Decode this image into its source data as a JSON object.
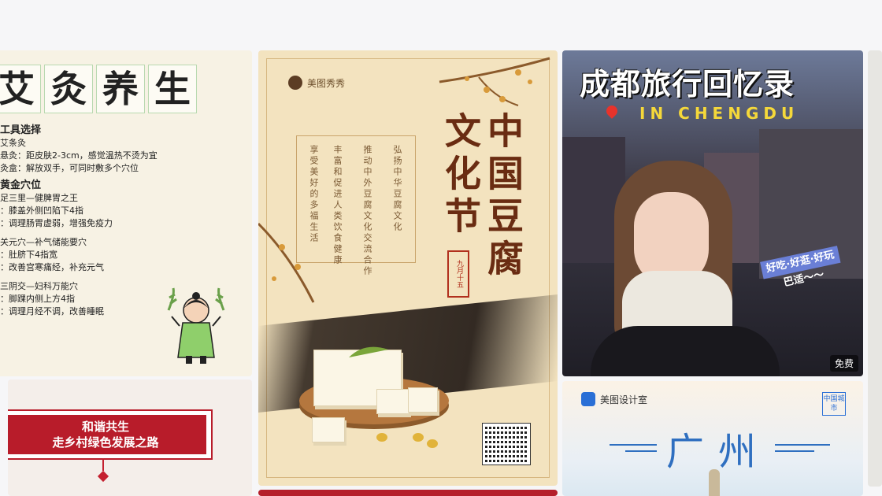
{
  "cards": [
    {
      "title_chars": [
        "艾",
        "灸",
        "养",
        "生"
      ],
      "lines": [
        {
          "text": "工具选择",
          "heading": true
        },
        {
          "text": "艾条灸",
          "heading": false
        },
        {
          "text": "悬灸：距皮肤2-3cm，感觉温热不烫为宜",
          "heading": false
        },
        {
          "text": "灸盒：解放双手，可同时敷多个穴位",
          "heading": false
        },
        {
          "text": "黄金穴位",
          "heading": true
        },
        {
          "text": "足三里—健脾胃之王",
          "heading": false
        },
        {
          "text": "：膝盖外侧凹陷下4指",
          "heading": false
        },
        {
          "text": "：调理肠胃虚弱，增强免疫力",
          "heading": false
        },
        {
          "text": "关元穴—补气储能要穴",
          "heading": false
        },
        {
          "text": "：肚脐下4指宽",
          "heading": false
        },
        {
          "text": "：改善宫寒痛经，补充元气",
          "heading": false
        },
        {
          "text": "三阴交—妇科万能穴",
          "heading": false
        },
        {
          "text": "：脚踝内侧上方4指",
          "heading": false
        },
        {
          "text": "：调理月经不调，改善睡眠",
          "heading": false
        }
      ]
    },
    {
      "banner_line1": "和谐共生",
      "banner_line2": "走乡村绿色发展之路"
    },
    {
      "brand": "美图秀秀",
      "title_col1": "中国豆腐",
      "title_col2": "文化节",
      "seal": "九月十五",
      "vlines": [
        "弘扬中华豆腐文化",
        "推动中外豆腐文化交流合作",
        "丰富和促进人类饮食健康",
        "享受美好的多福生活"
      ]
    },
    {
      "title": "成都旅行回忆录",
      "subtitle": "IN CHENGDU",
      "tag_line1": "好吃·好逛·好玩",
      "tag_line2": "巴适～～",
      "badge": "免费"
    },
    {
      "brand": "美图设计室",
      "stamp": "中国城市",
      "city": "广州"
    }
  ]
}
